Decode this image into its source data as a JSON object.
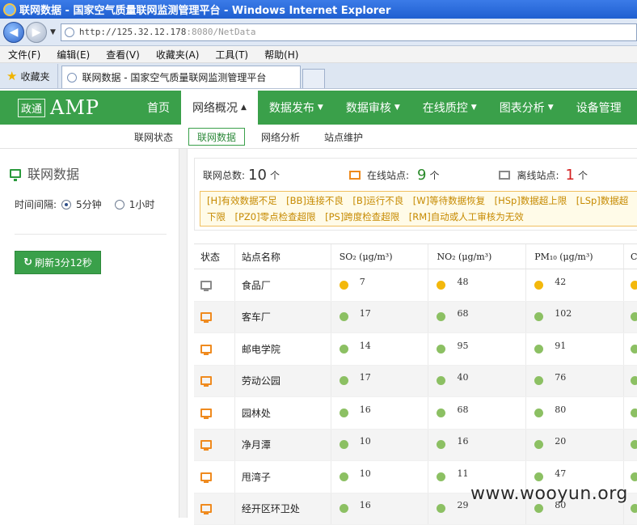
{
  "window": {
    "title": "联网数据 - 国家空气质量联网监测管理平台 - Windows Internet Explorer"
  },
  "browser": {
    "url_main": "http://125.32.12.178",
    "url_rest": ":8080/NetData",
    "menu": [
      "文件(F)",
      "编辑(E)",
      "查看(V)",
      "收藏夹(A)",
      "工具(T)",
      "帮助(H)"
    ],
    "favorites_label": "收藏夹",
    "tab_title": "联网数据 - 国家空气质量联网监测管理平台"
  },
  "app": {
    "logo_seal": "政通",
    "logo_text": "AMP",
    "nav": [
      {
        "label": "首页",
        "caret": ""
      },
      {
        "label": "网络概况",
        "caret": "▲"
      },
      {
        "label": "数据发布",
        "caret": "▼"
      },
      {
        "label": "数据审核",
        "caret": "▼"
      },
      {
        "label": "在线质控",
        "caret": "▼"
      },
      {
        "label": "图表分析",
        "caret": "▼"
      },
      {
        "label": "设备管理",
        "caret": ""
      }
    ],
    "subnav": [
      "联网状态",
      "联网数据",
      "网络分析",
      "站点维护"
    ]
  },
  "left": {
    "title": "联网数据",
    "interval_label": "时间间隔:",
    "option1": "5分钟",
    "option2": "1小时",
    "refresh": "刷新3分12秒"
  },
  "summary": {
    "total_label": "联网总数:",
    "total": "10",
    "unit": "个",
    "online_label": "在线站点:",
    "online": "9",
    "offline_label": "离线站点:",
    "offline": "1",
    "legend": "[H]有效数据不足　[BB]连接不良　[B]运行不良　[W]等待数据恢复　[HSp]数据超上限　[LSp]数据超下限　[PZ0]零点检查超限　[PS]跨度检查超限　[RM]自动或人工审核为无效",
    "legend_line2": "准　[RM]自动或人工审核为无效"
  },
  "table": {
    "headers": [
      "状态",
      "站点名称",
      "SO₂ (μg/m³)",
      "NO₂ (μg/m³)",
      "PM₁₀ (μg/m³)",
      "CO"
    ],
    "rows": [
      {
        "name": "食品厂",
        "status": "offline",
        "so2": "7",
        "no2": "48",
        "pm10": "42",
        "dot": "yellow"
      },
      {
        "name": "客车厂",
        "status": "online",
        "so2": "17",
        "no2": "68",
        "pm10": "102",
        "dot": "green"
      },
      {
        "name": "邮电学院",
        "status": "online",
        "so2": "14",
        "no2": "95",
        "pm10": "91",
        "dot": "green"
      },
      {
        "name": "劳动公园",
        "status": "online",
        "so2": "17",
        "no2": "40",
        "pm10": "76",
        "dot": "green"
      },
      {
        "name": "园林处",
        "status": "online",
        "so2": "16",
        "no2": "68",
        "pm10": "80",
        "dot": "green"
      },
      {
        "name": "净月潭",
        "status": "online",
        "so2": "10",
        "no2": "16",
        "pm10": "20",
        "dot": "green"
      },
      {
        "name": "甩湾子",
        "status": "online",
        "so2": "10",
        "no2": "11",
        "pm10": "47",
        "dot": "green"
      },
      {
        "name": "经开区环卫处",
        "status": "online",
        "so2": "16",
        "no2": "29",
        "pm10": "80",
        "dot": "green"
      }
    ]
  },
  "watermark": "www.wooyun.org"
}
